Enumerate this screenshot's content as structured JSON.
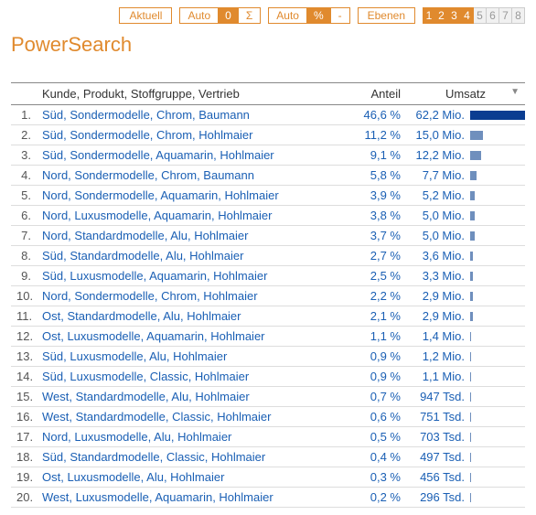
{
  "toolbar": {
    "aktuell": "Aktuell",
    "auto1": "Auto",
    "zero": "0",
    "sigma": "Σ",
    "auto2": "Auto",
    "percent": "%",
    "minus": "-",
    "ebenen": "Ebenen",
    "levels": [
      "1",
      "2",
      "3",
      "4",
      "5",
      "6",
      "7",
      "8"
    ],
    "activeLevel": 3
  },
  "title": "PowerSearch",
  "columns": {
    "desc": "Kunde, Produkt, Stoffgruppe, Vertrieb",
    "anteil": "Anteil",
    "umsatz": "Umsatz"
  },
  "maxBar": 62.2,
  "rows": [
    {
      "rank": "1.",
      "desc": "Süd, Sondermodelle, Chrom, Baumann",
      "anteil": "46,6 %",
      "umsatz": "62,2 Mio.",
      "bar": 62.2
    },
    {
      "rank": "2.",
      "desc": "Süd, Sondermodelle, Chrom, Hohlmaier",
      "anteil": "11,2 %",
      "umsatz": "15,0 Mio.",
      "bar": 15.0
    },
    {
      "rank": "3.",
      "desc": "Süd, Sondermodelle, Aquamarin, Hohlmaier",
      "anteil": "9,1 %",
      "umsatz": "12,2 Mio.",
      "bar": 12.2
    },
    {
      "rank": "4.",
      "desc": "Nord, Sondermodelle, Chrom, Baumann",
      "anteil": "5,8 %",
      "umsatz": "7,7 Mio.",
      "bar": 7.7
    },
    {
      "rank": "5.",
      "desc": "Nord, Sondermodelle, Aquamarin, Hohlmaier",
      "anteil": "3,9 %",
      "umsatz": "5,2 Mio.",
      "bar": 5.2
    },
    {
      "rank": "6.",
      "desc": "Nord, Luxusmodelle, Aquamarin, Hohlmaier",
      "anteil": "3,8 %",
      "umsatz": "5,0 Mio.",
      "bar": 5.0
    },
    {
      "rank": "7.",
      "desc": "Nord, Standardmodelle, Alu, Hohlmaier",
      "anteil": "3,7 %",
      "umsatz": "5,0 Mio.",
      "bar": 5.0
    },
    {
      "rank": "8.",
      "desc": "Süd, Standardmodelle, Alu, Hohlmaier",
      "anteil": "2,7 %",
      "umsatz": "3,6 Mio.",
      "bar": 3.6
    },
    {
      "rank": "9.",
      "desc": "Süd, Luxusmodelle, Aquamarin, Hohlmaier",
      "anteil": "2,5 %",
      "umsatz": "3,3 Mio.",
      "bar": 3.3
    },
    {
      "rank": "10.",
      "desc": "Nord, Sondermodelle, Chrom, Hohlmaier",
      "anteil": "2,2 %",
      "umsatz": "2,9 Mio.",
      "bar": 2.9
    },
    {
      "rank": "11.",
      "desc": "Ost, Standardmodelle, Alu, Hohlmaier",
      "anteil": "2,1 %",
      "umsatz": "2,9 Mio.",
      "bar": 2.9
    },
    {
      "rank": "12.",
      "desc": "Ost, Luxusmodelle, Aquamarin, Hohlmaier",
      "anteil": "1,1 %",
      "umsatz": "1,4 Mio.",
      "bar": 1.4
    },
    {
      "rank": "13.",
      "desc": "Süd, Luxusmodelle, Alu, Hohlmaier",
      "anteil": "0,9 %",
      "umsatz": "1,2 Mio.",
      "bar": 1.2
    },
    {
      "rank": "14.",
      "desc": "Süd, Luxusmodelle, Classic, Hohlmaier",
      "anteil": "0,9 %",
      "umsatz": "1,1 Mio.",
      "bar": 1.1
    },
    {
      "rank": "15.",
      "desc": "West, Standardmodelle, Alu, Hohlmaier",
      "anteil": "0,7 %",
      "umsatz": "947 Tsd.",
      "bar": 0.947
    },
    {
      "rank": "16.",
      "desc": "West, Standardmodelle, Classic, Hohlmaier",
      "anteil": "0,6 %",
      "umsatz": "751 Tsd.",
      "bar": 0.751
    },
    {
      "rank": "17.",
      "desc": "Nord, Luxusmodelle, Alu, Hohlmaier",
      "anteil": "0,5 %",
      "umsatz": "703 Tsd.",
      "bar": 0.703
    },
    {
      "rank": "18.",
      "desc": "Süd, Standardmodelle, Classic, Hohlmaier",
      "anteil": "0,4 %",
      "umsatz": "497 Tsd.",
      "bar": 0.497
    },
    {
      "rank": "19.",
      "desc": "Ost, Luxusmodelle, Alu, Hohlmaier",
      "anteil": "0,3 %",
      "umsatz": "456 Tsd.",
      "bar": 0.456
    },
    {
      "rank": "20.",
      "desc": "West, Luxusmodelle, Aquamarin, Hohlmaier",
      "anteil": "0,2 %",
      "umsatz": "296 Tsd.",
      "bar": 0.296
    }
  ]
}
